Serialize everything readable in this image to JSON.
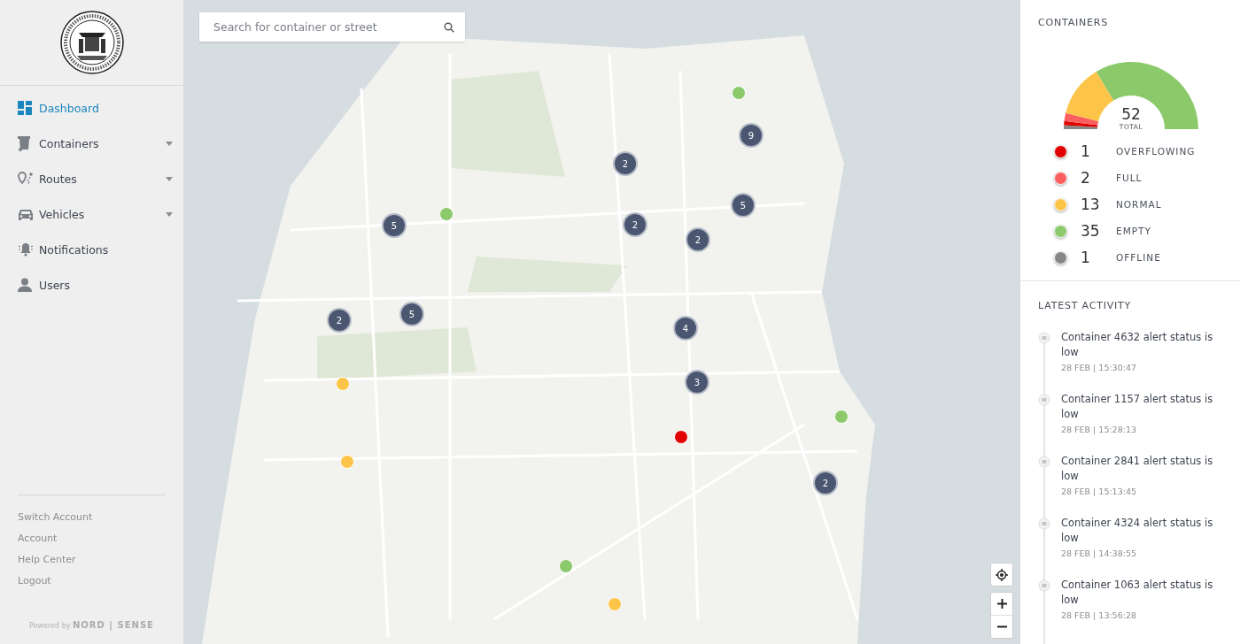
{
  "sidebar": {
    "nav_items": [
      {
        "label": "Dashboard",
        "selected": true,
        "expandable": false
      },
      {
        "label": "Containers",
        "selected": false,
        "expandable": true
      },
      {
        "label": "Routes",
        "selected": false,
        "expandable": true
      },
      {
        "label": "Vehicles",
        "selected": false,
        "expandable": true
      },
      {
        "label": "Notifications",
        "selected": false,
        "expandable": false
      },
      {
        "label": "Users",
        "selected": false,
        "expandable": false
      }
    ],
    "account_links": [
      "Switch Account",
      "Account",
      "Help Center",
      "Logout"
    ],
    "footer": "Powered by **NORD | SENSE**"
  },
  "map": {
    "search": {
      "placeholder": "Search for container or street"
    },
    "markers": [
      {
        "kind": "cluster",
        "count": "2"
      },
      {
        "kind": "cluster",
        "count": "9"
      },
      {
        "kind": "cluster",
        "count": "5"
      },
      {
        "kind": "cluster",
        "count": "2"
      },
      {
        "kind": "cluster",
        "count": "5"
      },
      {
        "kind": "cluster",
        "count": "2"
      },
      {
        "kind": "cluster",
        "count": "2"
      },
      {
        "kind": "cluster",
        "count": "5"
      },
      {
        "kind": "cluster",
        "count": "4"
      },
      {
        "kind": "cluster",
        "count": "3"
      },
      {
        "kind": "cluster",
        "count": "2"
      },
      {
        "kind": "dot",
        "color": "#8bc96b"
      },
      {
        "kind": "dot",
        "color": "#8bc96b"
      },
      {
        "kind": "dot",
        "color": "#fcc54a"
      },
      {
        "kind": "dot",
        "color": "#fcc54a"
      },
      {
        "kind": "dot",
        "color": "#e00000"
      },
      {
        "kind": "dot",
        "color": "#8bc96b"
      },
      {
        "kind": "dot",
        "color": "#8bc96b"
      },
      {
        "kind": "dot",
        "color": "#fcc54a"
      }
    ]
  },
  "containers": {
    "title": "CONTAINERS",
    "total": "52",
    "total_label": "TOTAL",
    "legend": [
      {
        "count": "1",
        "label": "OVERFLOWING",
        "color": "#e00000"
      },
      {
        "count": "2",
        "label": "FULL",
        "color": "#fb5f5f"
      },
      {
        "count": "13",
        "label": "NORMAL",
        "color": "#fcc54a"
      },
      {
        "count": "35",
        "label": "EMPTY",
        "color": "#8bc96b"
      },
      {
        "count": "1",
        "label": "OFFLINE",
        "color": "#868686"
      }
    ]
  },
  "latest_activity": {
    "title": "LATEST ACTIVITY",
    "items": [
      {
        "text": "Container 4632 alert status is low",
        "time": "28 FEB | 15:30:47"
      },
      {
        "text": "Container 1157 alert status is low",
        "time": "28 FEB | 15:28:13"
      },
      {
        "text": "Container 2841 alert status is low",
        "time": "28 FEB | 15:13:45"
      },
      {
        "text": "Container 4324 alert status is low",
        "time": "28 FEB | 14:38:55"
      },
      {
        "text": "Container 1063 alert status is low",
        "time": "28 FEB | 13:56:28"
      }
    ]
  }
}
